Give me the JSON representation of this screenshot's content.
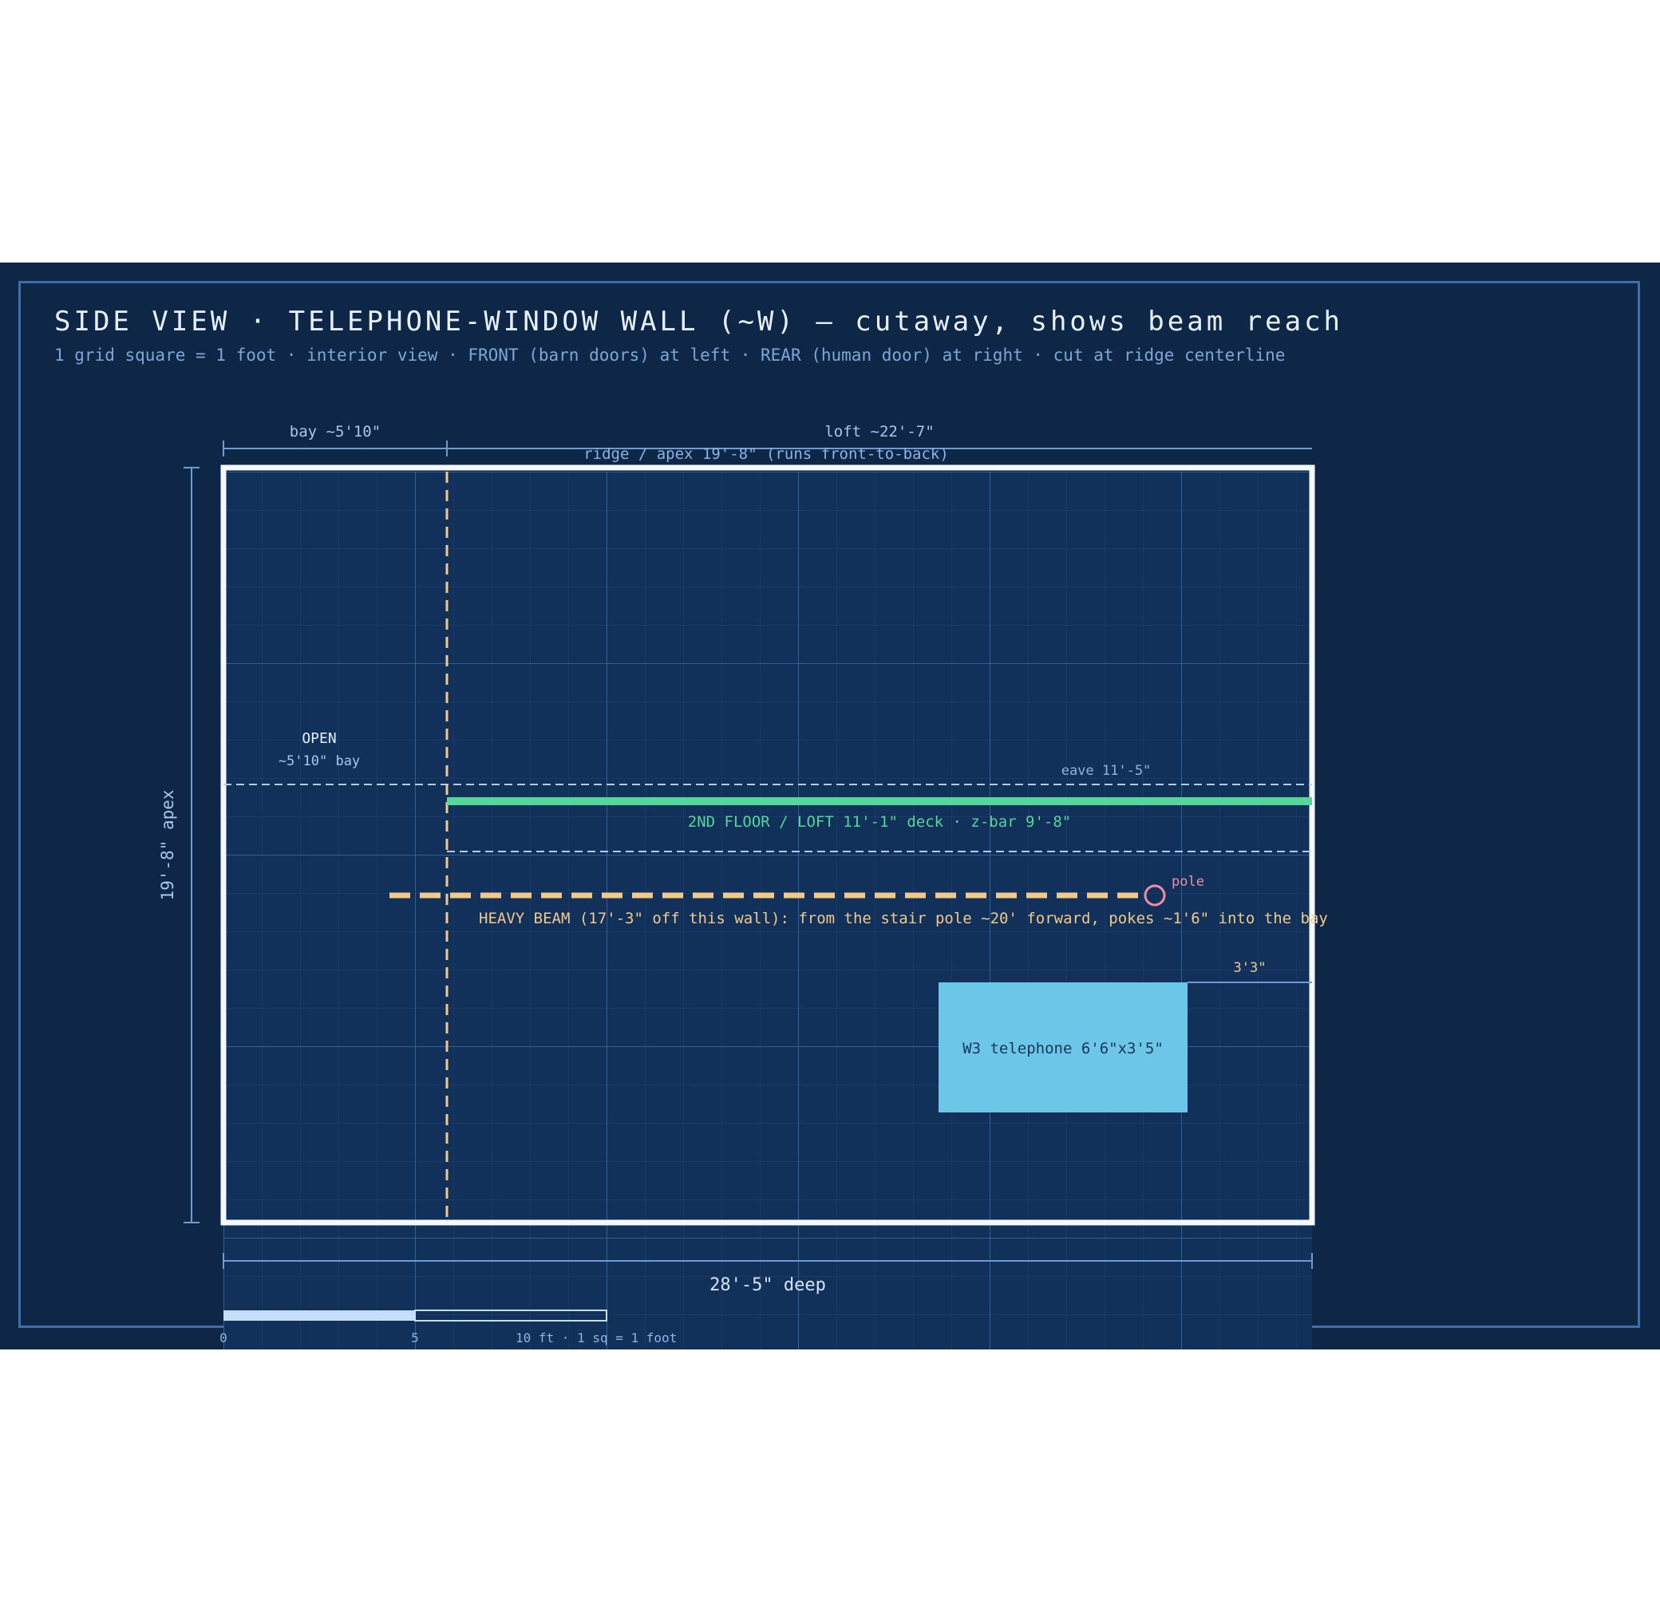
{
  "title": "SIDE VIEW · TELEPHONE-WINDOW WALL (~W) — cutaway, shows beam reach",
  "subtitle": "1 grid square = 1 foot · interior view · FRONT (barn doors) at left · REAR (human door) at right · cut at ridge centerline",
  "dimensions": {
    "bay": "bay ~5'10\"",
    "loft": "loft ~22'-7\"",
    "ridge": "ridge / apex 19'-8\" (runs front-to-back)",
    "height": "19'-8\" apex",
    "depth": "28'-5\" deep"
  },
  "labels": {
    "open": "OPEN",
    "open_sub": "~5'10\" bay",
    "eave": "eave 11'-5\"",
    "loft_floor": "2ND FLOOR / LOFT 11'-1\" deck · z-bar 9'-8\"",
    "pole": "pole",
    "beam": "HEAVY BEAM (17'-3\" off this wall): from the stair pole ~20' forward, pokes ~1'6\" into the bay",
    "window_offset": "3'3\"",
    "window": "W3 telephone 6'6\"x3'5\""
  },
  "scale_bar": {
    "tick0": "0",
    "tick5": "5",
    "tick10": "10 ft · 1 sq = 1 foot"
  },
  "colors": {
    "background": "#0e2747",
    "wall": "#f4f8ff",
    "loft": "#55d69a",
    "beam": "#f3c98a",
    "pole": "#f08da4",
    "window": "#6cc6e8"
  }
}
